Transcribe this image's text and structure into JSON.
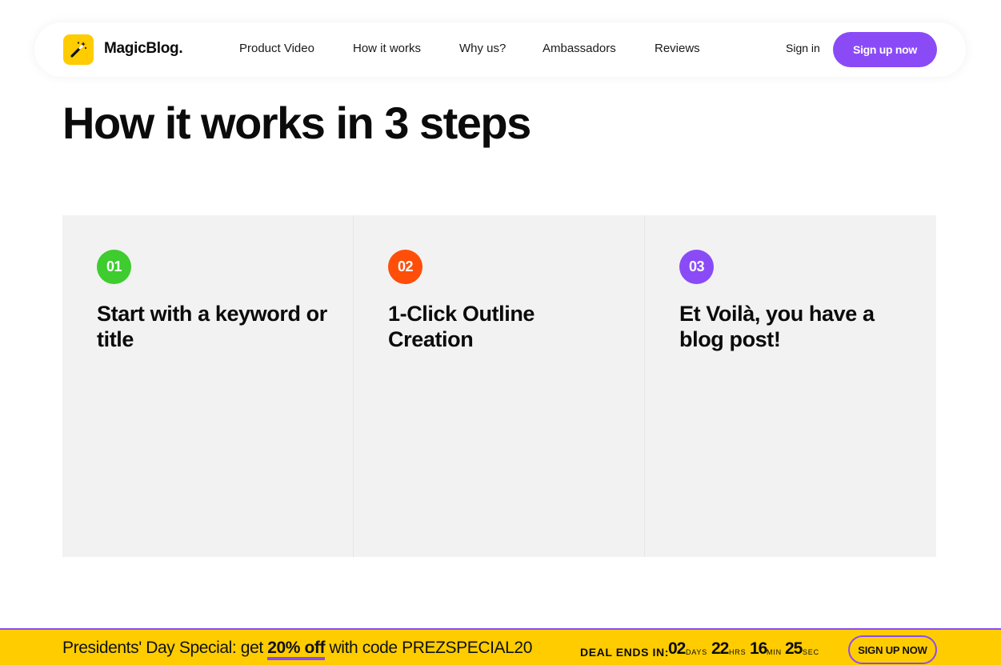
{
  "header": {
    "logo_text": "MagicBlog.",
    "logo_icon": "magic-wand-icon",
    "nav": [
      {
        "label": "Product Video"
      },
      {
        "label": "How it works"
      },
      {
        "label": "Why us?"
      },
      {
        "label": "Ambassadors"
      },
      {
        "label": "Reviews"
      }
    ],
    "signin_label": "Sign in",
    "signup_label": "Sign up now"
  },
  "main": {
    "title": "How it works in 3 steps",
    "steps": [
      {
        "number": "01",
        "title": "Start with a keyword or title",
        "color": "#3ecc2f"
      },
      {
        "number": "02",
        "title": "1-Click Outline Creation",
        "color": "#ff4e0a"
      },
      {
        "number": "03",
        "title": "Et Voilà, you have a blog post!",
        "color": "#8a4bf7"
      }
    ]
  },
  "promo": {
    "text_before": "Presidents' Day Special: get ",
    "highlight": "20% off",
    "text_after": " with code PREZSPECIAL20",
    "deal_label": "DEAL ENDS IN:",
    "countdown": [
      {
        "value": "02",
        "unit": "DAYS"
      },
      {
        "value": "22",
        "unit": "HRS"
      },
      {
        "value": "16",
        "unit": "MIN"
      },
      {
        "value": "25",
        "unit": "SEC"
      }
    ],
    "button_label": "SIGN UP NOW"
  },
  "colors": {
    "accent": "#8a4bf7",
    "brand_yellow": "#ffcc00",
    "card_bg": "#f2f2f2"
  }
}
